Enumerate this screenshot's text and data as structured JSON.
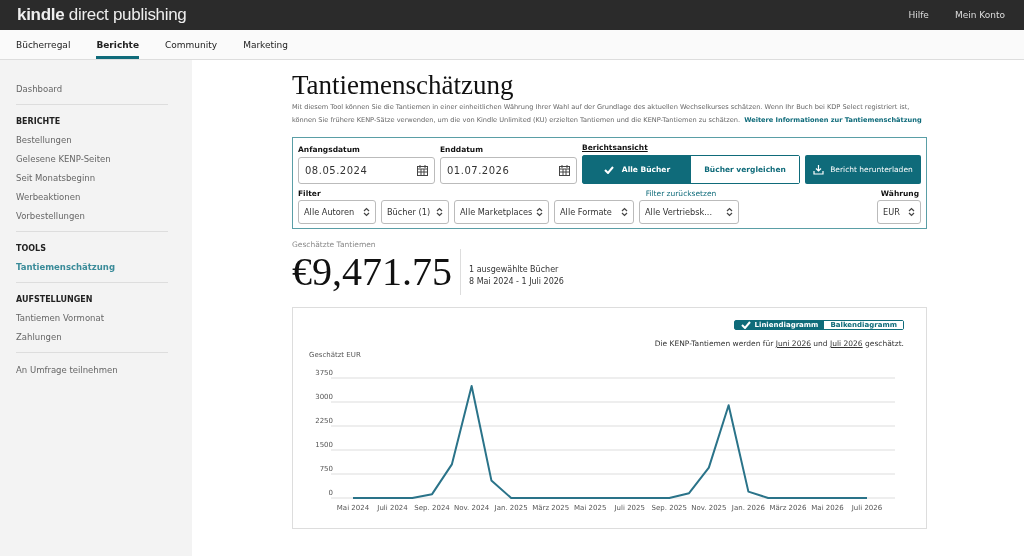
{
  "header": {
    "logo_bold": "kindle",
    "logo_rest": "direct publishing",
    "links": [
      "Hilfe",
      "Mein Konto"
    ]
  },
  "tabs": [
    {
      "label": "Bücherregal",
      "selected": false
    },
    {
      "label": "Berichte",
      "selected": true
    },
    {
      "label": "Community",
      "selected": false
    },
    {
      "label": "Marketing",
      "selected": false
    }
  ],
  "sidebar": {
    "sections": [
      {
        "items": [
          {
            "label": "Dashboard",
            "selected": false
          }
        ]
      },
      {
        "heading": "BERICHTE",
        "items": [
          {
            "label": "Bestellungen",
            "selected": false
          },
          {
            "label": "Gelesene KENP-Seiten",
            "selected": false
          },
          {
            "label": "Seit Monatsbeginn",
            "selected": false
          },
          {
            "label": "Werbeaktionen",
            "selected": false
          },
          {
            "label": "Vorbestellungen",
            "selected": false
          }
        ]
      },
      {
        "heading": "TOOLS",
        "items": [
          {
            "label": "Tantiemenschätzung",
            "selected": true
          }
        ]
      },
      {
        "heading": "AUFSTELLUNGEN",
        "items": [
          {
            "label": "Tantiemen Vormonat",
            "selected": false
          },
          {
            "label": "Zahlungen",
            "selected": false
          }
        ]
      },
      {
        "items": [
          {
            "label": "An Umfrage teilnehmen",
            "selected": false
          }
        ]
      }
    ]
  },
  "page": {
    "title": "Tantiemenschätzung",
    "description": "Mit diesem Tool können Sie die Tantiemen in einer einheitlichen Währung Ihrer Wahl auf der Grundlage des aktuellen Wechselkurses schätzen. Wenn Ihr Buch bei KDP Select registriert ist, können Sie frühere KENP-Sätze verwenden, um die von Kindle Unlimited (KU) erzielten Tantiemen und die KENP-Tantiemen zu schätzen.",
    "more_link": "Weitere Informationen zur Tantiemenschätzung"
  },
  "form": {
    "start_label": "Anfangsdatum",
    "start_value": "08.05.2024",
    "end_label": "Enddatum",
    "end_value": "01.07.2026",
    "view_label": "Berichtsansicht",
    "view_options": [
      {
        "label": "Alle Bücher",
        "selected": true
      },
      {
        "label": "Bücher vergleichen",
        "selected": false
      }
    ],
    "download": "Bericht herunterladen",
    "filter_label": "Filter",
    "reset": "Filter zurücksetzen",
    "filters": [
      "Alle Autoren",
      "Bücher (1)",
      "Alle Marketplaces",
      "Alle Formate",
      "Alle Vertriebsk..."
    ],
    "currency_label": "Währung",
    "currency": "EUR"
  },
  "summary": {
    "label": "Geschätzte Tantiemen",
    "amount": "€9,471.75",
    "books": "1 ausgewählte Bücher",
    "range": "8 Mai 2024 - 1 Juli 2026"
  },
  "chart_panel": {
    "types": [
      {
        "label": "Liniendiagramm",
        "selected": true
      },
      {
        "label": "Balkendiagramm",
        "selected": false
      }
    ],
    "note": {
      "text_1": "Die KENP-Tantiemen werden für",
      "link_1": "Juni 2026",
      "text_2": "und",
      "link_2": "Juli 2026",
      "text_3": "geschätzt."
    },
    "chart_data": {
      "type": "line",
      "ylabel": "Geschätzt EUR",
      "categories": [
        "Mai 2024",
        null,
        "Juli 2024",
        null,
        "Sep. 2024",
        null,
        "Nov. 2024",
        null,
        "Jan. 2025",
        null,
        "März 2025",
        null,
        "Mai 2025",
        null,
        "Juli 2025",
        null,
        "Sep. 2025",
        null,
        "Nov. 2025",
        null,
        "Jan. 2026",
        null,
        "März 2026",
        null,
        "Mai 2026",
        null,
        "Juli 2026"
      ],
      "series": [
        {
          "color": "#2a7389",
          "values": [
            0,
            0,
            0,
            0,
            120,
            1050,
            3500,
            550,
            0,
            0,
            0,
            0,
            0,
            0,
            0,
            0,
            0,
            150,
            950,
            2900,
            200,
            0,
            0,
            0,
            0,
            0,
            0
          ]
        }
      ],
      "ylim": [
        0,
        3750
      ],
      "yticks": [
        0,
        750,
        1500,
        2250,
        3000,
        3750
      ],
      "grid": true
    }
  }
}
